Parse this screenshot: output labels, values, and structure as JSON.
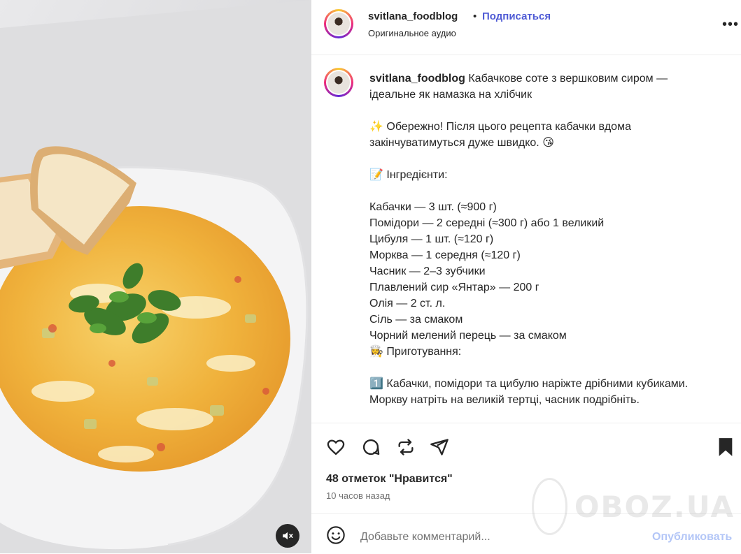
{
  "header": {
    "username": "svitlana_foodblog",
    "dot": "•",
    "follow_label": "Подписаться",
    "audio": "Оригинальное аудио",
    "more": "•••"
  },
  "caption": {
    "username": "svitlana_foodblog",
    "title": " Кабачкове соте з вершковим сиром — ідеальне як намазка на хлібчик",
    "warning": "✨ Обережно! Після цього рецепта кабачки вдома закінчуватимуться дуже швидко. 😘",
    "ingredients_heading": "📝 Інгредієнти:",
    "ingredients": [
      "Кабачки — 3 шт. (≈900 г)",
      "Помідори — 2 середні (≈300 г) або 1 великий",
      "Цибуля — 1 шт. (≈120 г)",
      "Морква — 1 середня (≈120 г)",
      "Часник — 2–3 зубчики",
      "Плавлений сир «Янтар» — 200 г",
      "Олія — 2 ст. л.",
      "Сіль — за смаком",
      "Чорний мелений перець — за смаком"
    ],
    "prep_heading": "👩‍🍳 Приготування:",
    "step1": "1️⃣ Кабачки, помідори та цибулю наріжте дрібними кубиками. Моркву натріть на великій тертці, часник подрібніть."
  },
  "stats": {
    "likes": "48 отметок \"Нравится\"",
    "time": "10 часов назад"
  },
  "comment": {
    "placeholder": "Добавьте комментарий...",
    "post_label": "Опубликовать"
  },
  "watermark": "OBOZ.UA",
  "colors": {
    "accent": "#4f5bd5",
    "post_disabled": "#b3c6f7"
  },
  "icons": [
    "heart-icon",
    "comment-icon",
    "repost-icon",
    "share-icon",
    "bookmark-icon",
    "emoji-icon",
    "mute-icon"
  ]
}
